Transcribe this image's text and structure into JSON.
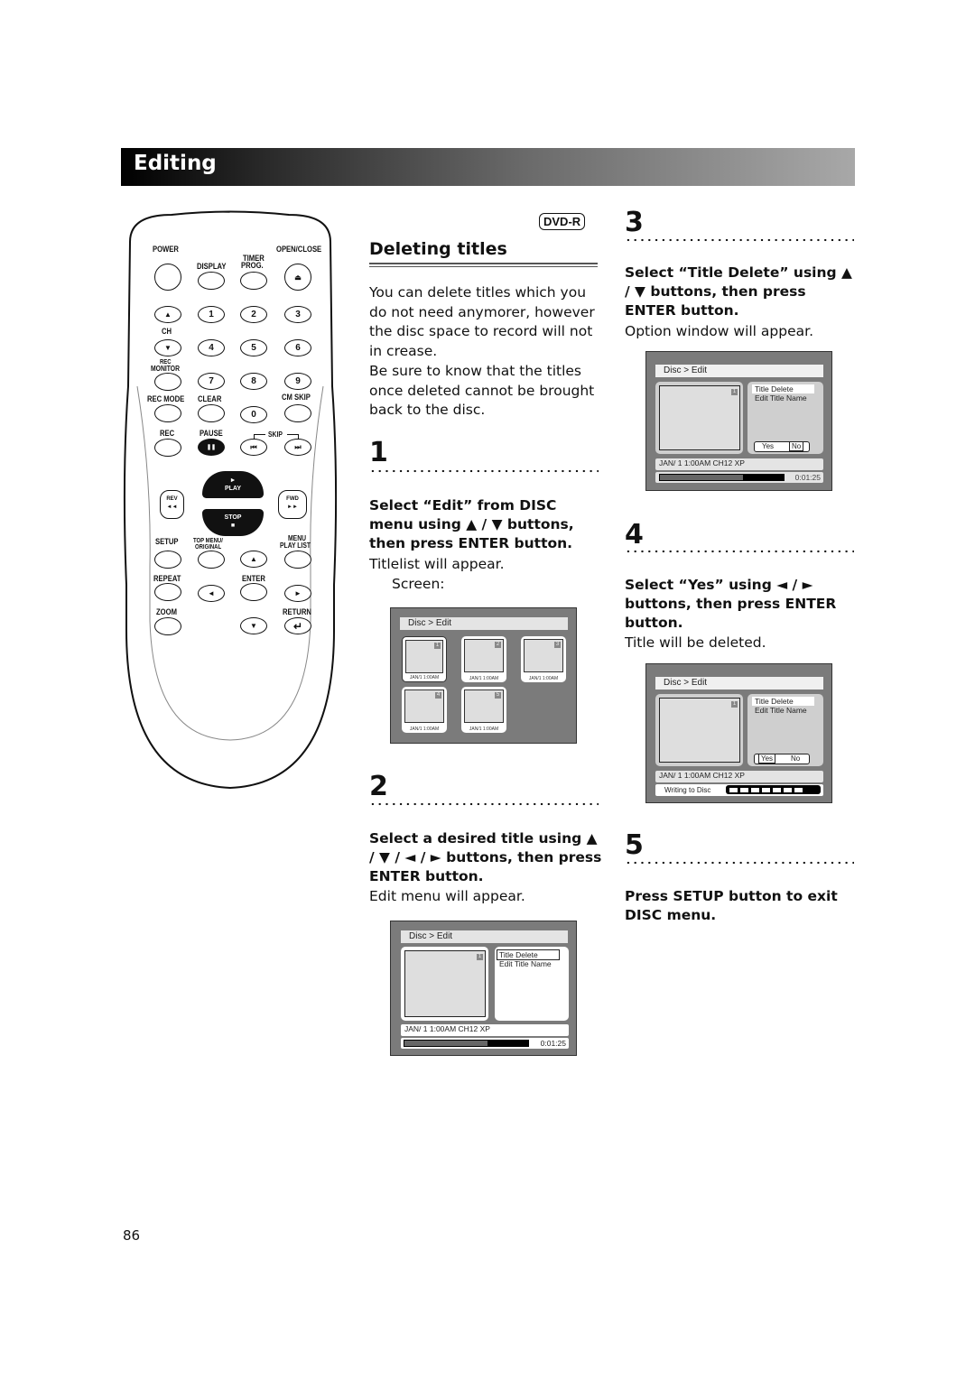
{
  "header": {
    "section_title": "Editing"
  },
  "remote": {
    "labels": {
      "power": "POWER",
      "display": "DISPLAY",
      "timer_prog": "TIMER PROG.",
      "timer": "TIMER",
      "prog": "PROG.",
      "open_close": "OPEN/CLOSE",
      "ch": "CH",
      "rec_monitor_1": "REC",
      "rec_monitor_2": "MONITOR",
      "rec_mode": "REC MODE",
      "clear": "CLEAR",
      "cm_skip": "CM SKIP",
      "rec": "REC",
      "pause": "PAUSE",
      "skip": "SKIP",
      "play": "PLAY",
      "stop": "STOP",
      "rev": "REV",
      "fwd": "FWD",
      "setup": "SETUP",
      "top_menu_1": "TOP MENU/",
      "top_menu_2": "ORIGINAL",
      "menu_1": "MENU",
      "menu_2": "PLAY LIST",
      "repeat": "REPEAT",
      "enter": "ENTER",
      "zoom": "ZOOM",
      "return": "RETURN"
    },
    "digits": [
      "1",
      "2",
      "3",
      "4",
      "5",
      "6",
      "7",
      "8",
      "9",
      "0"
    ],
    "glyphs": {
      "eject": "⏏",
      "up": "▲",
      "down": "▼",
      "left": "◄",
      "right": "►",
      "pause": "❚❚",
      "skip_back": "⏮",
      "skip_fwd": "⏭",
      "play": "►",
      "stop": "■",
      "rev": "◄◄",
      "fwd": "►►",
      "return": "↵"
    }
  },
  "intro": {
    "badge": "DVD-R",
    "title": "Deleting titles",
    "paragraph_1": "You can delete titles which you do not need anymorer, however the disc space to record will not in crease.",
    "paragraph_2": "Be sure to know that the titles once deleted cannot be brought back to the disc."
  },
  "steps": [
    {
      "number": "1",
      "instruction": "Select “Edit” from DISC menu using ▲ / ▼ buttons, then press ENTER button.",
      "result": "Titlelist will appear.",
      "extra": "Screen:"
    },
    {
      "number": "2",
      "instruction": "Select a desired title using ▲ / ▼ / ◄ / ► buttons, then press ENTER button.",
      "result": "Edit menu will appear."
    },
    {
      "number": "3",
      "instruction": "Select “Title Delete” using ▲ / ▼ buttons, then press ENTER button.",
      "result": "Option window will appear."
    },
    {
      "number": "4",
      "instruction": "Select “Yes” using ◄ / ► buttons, then press ENTER button.",
      "result": "Title will be deleted."
    },
    {
      "number": "5",
      "instruction": "Press SETUP button to exit DISC menu."
    }
  ],
  "screens": {
    "titlelist": {
      "breadcrumb": "Disc > Edit",
      "thumbs": [
        {
          "num": "1",
          "caption": "JAN/1   1:00AM",
          "selected": true
        },
        {
          "num": "2",
          "caption": "JAN/1   1:00AM",
          "selected": false
        },
        {
          "num": "3",
          "caption": "JAN/1   1:00AM",
          "selected": false
        },
        {
          "num": "4",
          "caption": "JAN/1   1:00AM",
          "selected": false
        },
        {
          "num": "5",
          "caption": "JAN/1   1:00AM",
          "selected": false
        }
      ]
    },
    "edit_menu": {
      "breadcrumb": "Disc > Edit",
      "thumb_num": "1",
      "menu": [
        "Title Delete",
        "Edit Title Name"
      ],
      "info": "JAN/ 1   1:00AM  CH12     XP",
      "time": "0:01:25",
      "progress": 0.67
    },
    "option_window": {
      "breadcrumb": "Disc > Edit",
      "thumb_num": "1",
      "menu": [
        "Title Delete",
        "Edit Title Name"
      ],
      "yes": "Yes",
      "no": "No",
      "selected": "No",
      "info": "JAN/ 1   1:00AM  CH12     XP",
      "time": "0:01:25",
      "progress": 0.67
    },
    "writing": {
      "breadcrumb": "Disc > Edit",
      "thumb_num": "1",
      "menu": [
        "Title Delete",
        "Edit Title Name"
      ],
      "yes": "Yes",
      "no": "No",
      "selected": "Yes",
      "info": "JAN/ 1   1:00AM  CH12     XP",
      "status": "Writing to Disc",
      "segments": 7
    }
  },
  "footer": {
    "page_number": "86"
  }
}
